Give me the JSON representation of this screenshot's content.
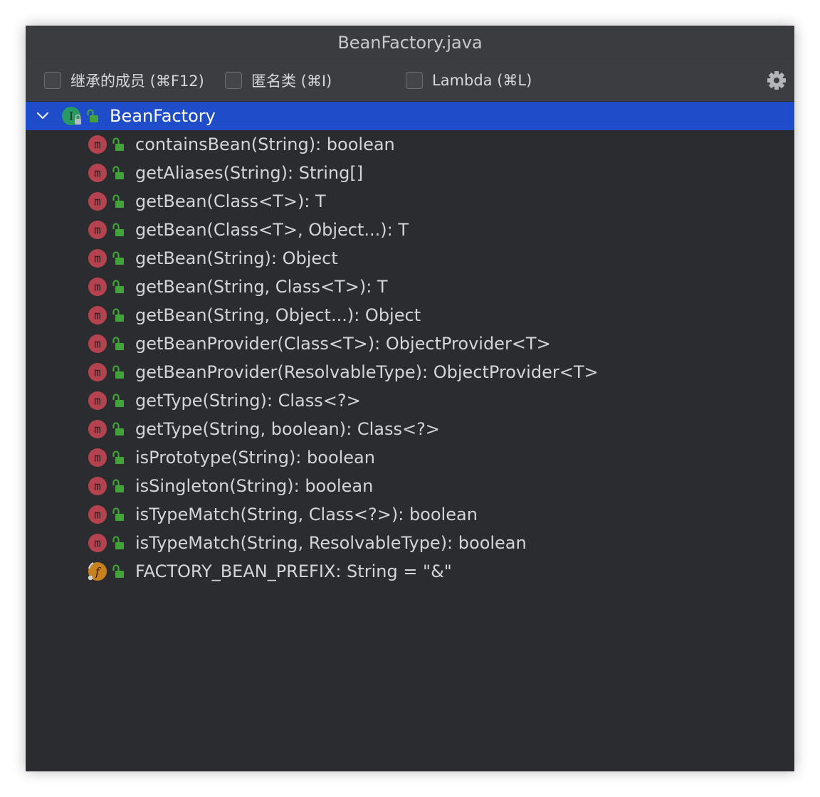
{
  "window": {
    "title": "BeanFactory.java"
  },
  "toolbar": {
    "inherited_label": "继承的成员 (⌘F12)",
    "anonymous_label": "匿名类 (⌘I)",
    "lambda_label": "Lambda (⌘L)",
    "settings_icon": "gear-icon"
  },
  "tree": {
    "root": {
      "label": "BeanFactory",
      "icon": "interface-icon",
      "expanded": true,
      "selected": true
    },
    "members": [
      {
        "label": "containsBean(String): boolean",
        "icon": "method-icon"
      },
      {
        "label": "getAliases(String): String[]",
        "icon": "method-icon"
      },
      {
        "label": "getBean(Class<T>): T",
        "icon": "method-icon"
      },
      {
        "label": "getBean(Class<T>, Object...): T",
        "icon": "method-icon"
      },
      {
        "label": "getBean(String): Object",
        "icon": "method-icon"
      },
      {
        "label": "getBean(String, Class<T>): T",
        "icon": "method-icon"
      },
      {
        "label": "getBean(String, Object...): Object",
        "icon": "method-icon"
      },
      {
        "label": "getBeanProvider(Class<T>): ObjectProvider<T>",
        "icon": "method-icon"
      },
      {
        "label": "getBeanProvider(ResolvableType): ObjectProvider<T>",
        "icon": "method-icon"
      },
      {
        "label": "getType(String): Class<?>",
        "icon": "method-icon"
      },
      {
        "label": "getType(String, boolean): Class<?>",
        "icon": "method-icon"
      },
      {
        "label": "isPrototype(String): boolean",
        "icon": "method-icon"
      },
      {
        "label": "isSingleton(String): boolean",
        "icon": "method-icon"
      },
      {
        "label": "isTypeMatch(String, Class<?>): boolean",
        "icon": "method-icon"
      },
      {
        "label": "isTypeMatch(String, ResolvableType): boolean",
        "icon": "method-icon"
      },
      {
        "label": "FACTORY_BEAN_PREFIX: String = \"&\"",
        "icon": "field-icon"
      }
    ]
  },
  "colors": {
    "background": "#2b2c2f",
    "toolbar": "#3b3d41",
    "selection": "#1f4cc8",
    "method_icon": "#b5434f",
    "field_icon": "#c7811f",
    "interface_icon": "#2a9a63",
    "public_lock": "#42a33a"
  }
}
